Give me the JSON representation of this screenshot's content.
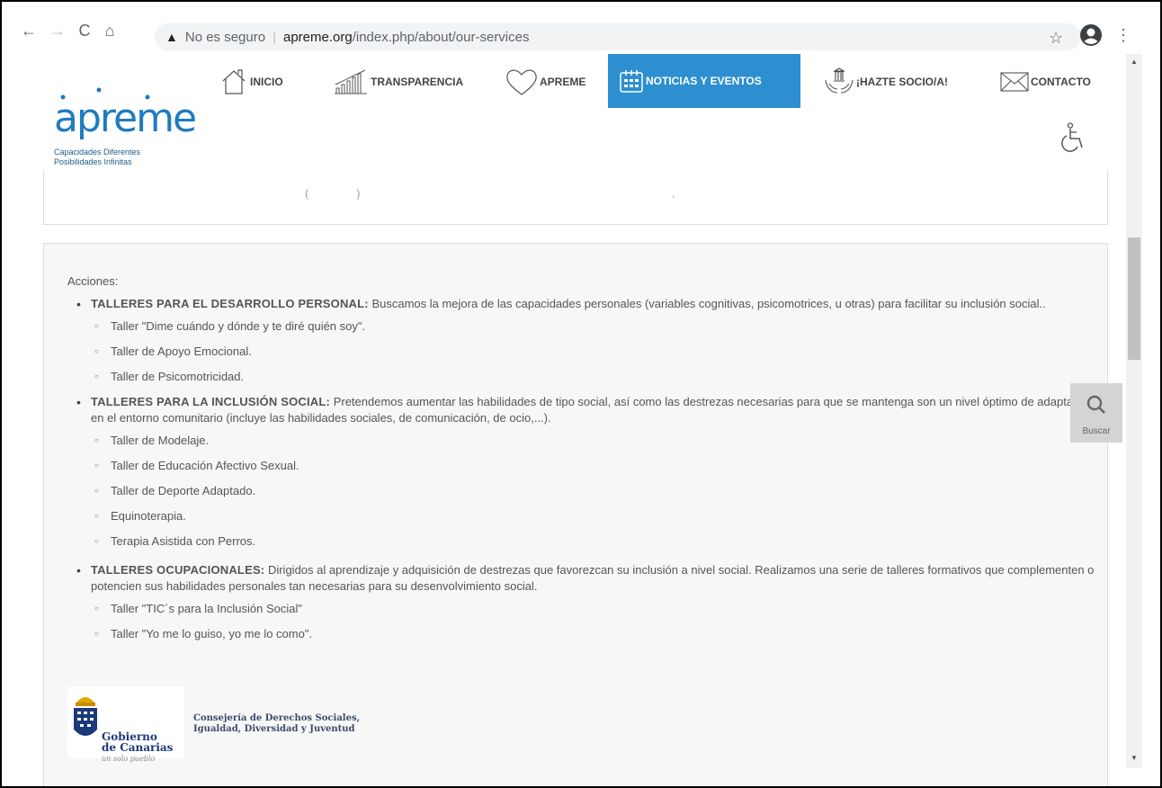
{
  "browser": {
    "warning_label": "No es seguro",
    "url_host": "apreme.org",
    "url_path": "/index.php/about/our-services"
  },
  "header": {
    "logo_text": "apreme",
    "logo_tagline_1": "Capacidades Diferentes",
    "logo_tagline_2": "Posibilidades Infinitas",
    "nav": [
      {
        "label": "INICIO",
        "icon": "house-icon"
      },
      {
        "label": "TRANSPARENCIA",
        "icon": "bar-chart-icon"
      },
      {
        "label": "APREME",
        "icon": "heart-icon"
      },
      {
        "label": "NOTICIAS Y EVENTOS",
        "icon": "calendar-icon"
      },
      {
        "label": "¡HAZTE SOCIO/A!",
        "icon": "hands-building-icon"
      },
      {
        "label": "CONTACTO",
        "icon": "envelope-icon"
      }
    ],
    "active_color": "#2d8fcf"
  },
  "content": {
    "intro": "Acciones:",
    "items": [
      {
        "title": "TALLERES PARA EL DESARROLLO PERSONAL:",
        "text": " Buscamos la mejora de las capacidades personales (variables cognitivas, psicomotrices, u otras) para facilitar su inclusión social..",
        "subs": [
          "Taller \"Dime cuándo y dónde y te diré quién soy\".",
          "Taller de Apoyo Emocional.",
          "Taller de Psicomotricidad."
        ]
      },
      {
        "title": "TALLERES PARA LA INCLUSIÓN SOCIAL:",
        "text": " Pretendemos aumentar las habilidades de tipo social, así como las destrezas necesarias para que se mantenga son un nivel óptimo de adaptación en el entorno comunitario (incluye las habilidades sociales, de comunicación, de ocio,...).",
        "subs": [
          "Taller de Modelaje.",
          "Taller de Educación Afectivo Sexual.",
          "Taller de Deporte Adaptado.",
          "Equinoterapia.",
          "Terapia Asistida con Perros."
        ]
      },
      {
        "title": "TALLERES OCUPACIONALES:",
        "text": " Dirigidos al aprendizaje y adquisición de destrezas que favorezcan su inclusión a nivel social. Realizamos una serie de talleres formativos que complementen o potencien sus habilidades personales tan necesarias para su desenvolvimiento social.",
        "subs": [
          "Taller \"TIC´s para la Inclusión Social\"",
          "Taller \"Yo me lo guiso, yo me lo como\"."
        ]
      }
    ],
    "gobierno_name_1": "Gobierno",
    "gobierno_name_2": "de Canarias",
    "gobierno_sub": "un solo pueblo",
    "consejeria_1": "Consejería de Derechos Sociales,",
    "consejeria_2": "Igualdad, Diversidad y Juventud"
  },
  "search": {
    "label": "Buscar"
  }
}
